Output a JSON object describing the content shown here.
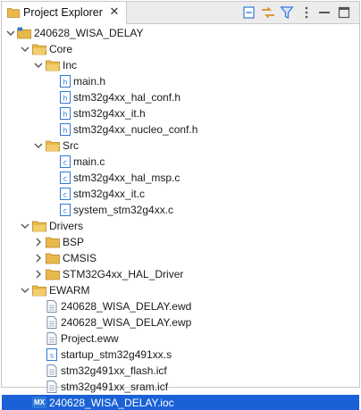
{
  "tab": {
    "title": "Project Explorer",
    "close_glyph": "✕"
  },
  "toolbar": {
    "buttons": [
      {
        "name": "collapse-all-icon"
      },
      {
        "name": "link-with-editor-icon"
      },
      {
        "name": "filter-icon"
      },
      {
        "name": "view-menu-icon"
      },
      {
        "name": "minimize-icon"
      },
      {
        "name": "maximize-icon"
      }
    ]
  },
  "tree": {
    "project": "240628_WISA_DELAY",
    "core": "Core",
    "inc": "Inc",
    "inc_files": [
      "main.h",
      "stm32g4xx_hal_conf.h",
      "stm32g4xx_it.h",
      "stm32g4xx_nucleo_conf.h"
    ],
    "src": "Src",
    "src_files": [
      "main.c",
      "stm32g4xx_hal_msp.c",
      "stm32g4xx_it.c",
      "system_stm32g4xx.c"
    ],
    "drivers": "Drivers",
    "driver_folders": [
      "BSP",
      "CMSIS",
      "STM32G4xx_HAL_Driver"
    ],
    "ewarm": "EWARM",
    "ewarm_files": [
      "240628_WISA_DELAY.ewd",
      "240628_WISA_DELAY.ewp",
      "Project.eww",
      "startup_stm32g491xx.s",
      "stm32g491xx_flash.icf",
      "stm32g491xx_sram.icf"
    ],
    "ioc_file": "240628_WISA_DELAY.ioc",
    "mx_badge": "MX"
  },
  "colors": {
    "selection": "#1a61d7",
    "folder": "#e8b84a",
    "accent_icon": "#2f7ad8"
  }
}
